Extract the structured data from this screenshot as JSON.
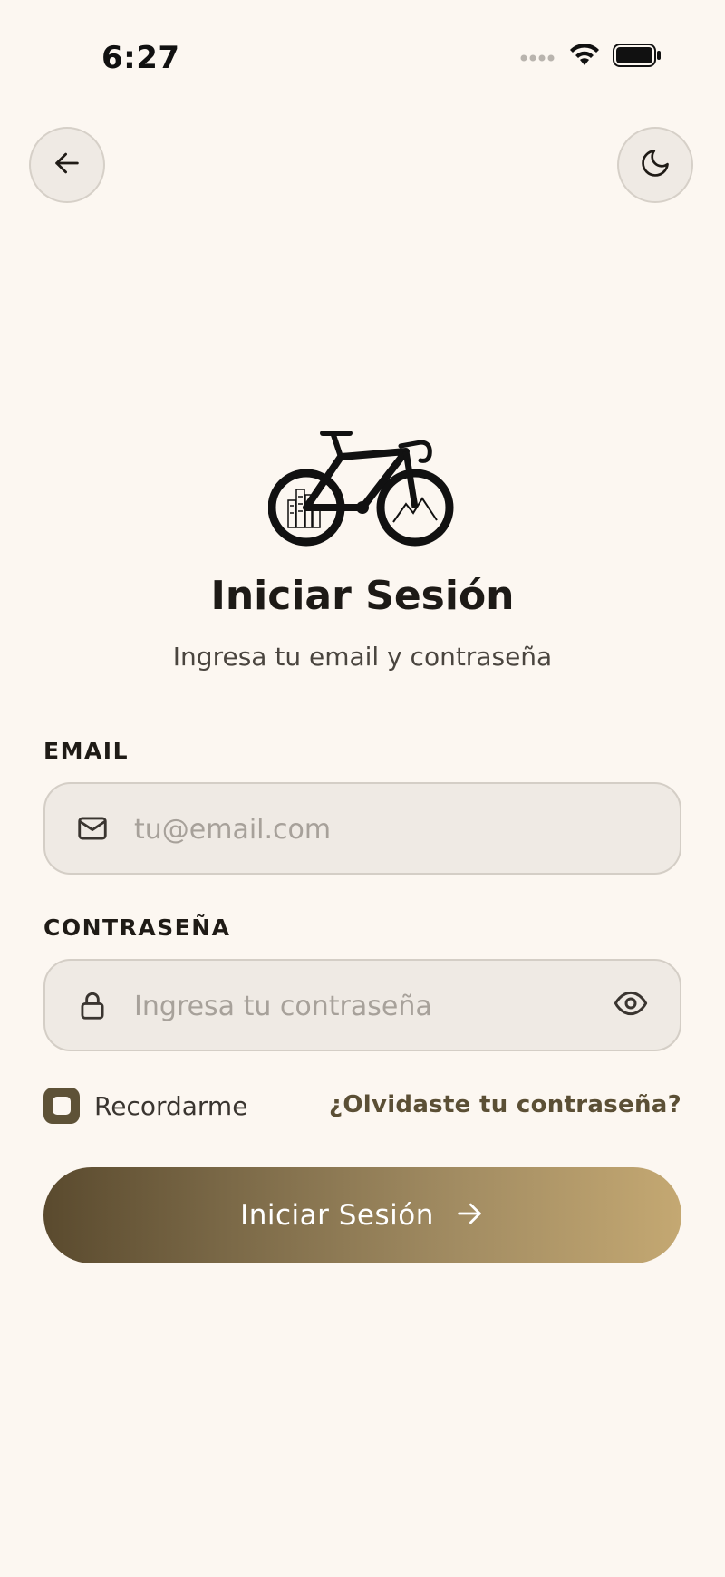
{
  "status_bar": {
    "time": "6:27",
    "icons": [
      "cellular-icon",
      "wifi-icon",
      "battery-icon"
    ]
  },
  "header": {
    "back_icon": "arrow-left-icon",
    "theme_icon": "moon-icon"
  },
  "logo": {
    "icon": "bicycle-icon"
  },
  "title": "Iniciar Sesión",
  "subtitle": "Ingresa tu email y contraseña",
  "form": {
    "email": {
      "label": "EMAIL",
      "placeholder": "tu@email.com",
      "value": "",
      "icon": "mail-icon"
    },
    "password": {
      "label": "CONTRASEÑA",
      "placeholder": "Ingresa tu contraseña",
      "value": "",
      "icon": "lock-icon",
      "toggle_icon": "eye-icon"
    },
    "remember_label": "Recordarme",
    "forgot_label": "¿Olvidaste tu contraseña?",
    "submit_label": "Iniciar Sesión",
    "submit_icon": "arrow-right-icon"
  },
  "colors": {
    "background": "#fcf7f1",
    "field_bg": "#efeae4",
    "accent_dark": "#5a4a2e",
    "accent_light": "#c4a872",
    "link": "#5b4f35"
  }
}
